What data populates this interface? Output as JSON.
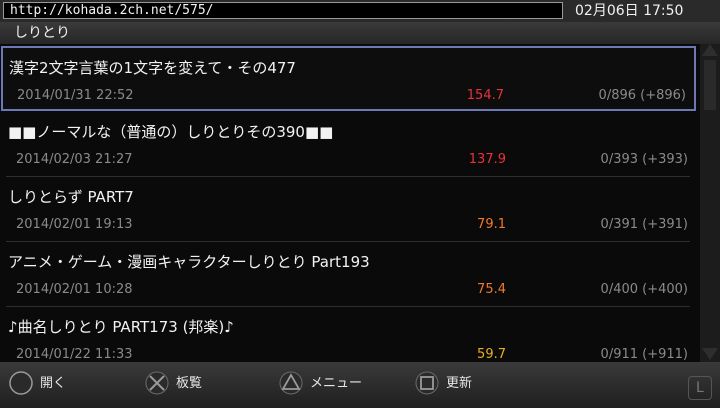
{
  "browser": {
    "url": "http://kohada.2ch.net/575/",
    "datetime": "02月06日 17:50"
  },
  "board": {
    "name": "しりとり"
  },
  "threads": [
    {
      "title": "漢字2文字言葉の1文字を変えて・その477",
      "date": "2014/01/31 22:52",
      "speed": "154.7",
      "speed_color": "#e8323c",
      "count": "0/896 (+896)",
      "selected": true
    },
    {
      "title": "■■ノーマルな（普通の）しりとりその390■■",
      "date": "2014/02/03 21:27",
      "speed": "137.9",
      "speed_color": "#e8323c",
      "count": "0/393 (+393)"
    },
    {
      "title": "しりとらず PART7",
      "date": "2014/02/01 19:13",
      "speed": "79.1",
      "speed_color": "#f07a2a",
      "count": "0/391 (+391)"
    },
    {
      "title": "アニメ・ゲーム・漫画キャラクターしりとり Part193",
      "date": "2014/02/01 10:28",
      "speed": "75.4",
      "speed_color": "#f07a2a",
      "count": "0/400 (+400)"
    },
    {
      "title": "♪曲名しりとり PART173 (邦楽)♪",
      "date": "2014/01/22 11:33",
      "speed": "59.7",
      "speed_color": "#e8b020",
      "count": "0/911 (+911)"
    }
  ],
  "actions": {
    "open": {
      "label": "開く",
      "icon": "circle-button-icon"
    },
    "boards": {
      "label": "板覧",
      "icon": "cross-button-icon"
    },
    "menu": {
      "label": "メニュー",
      "icon": "triangle-button-icon"
    },
    "refresh": {
      "label": "更新",
      "icon": "square-button-icon"
    },
    "l_button": {
      "label": "L",
      "icon": "l-button-icon"
    }
  }
}
